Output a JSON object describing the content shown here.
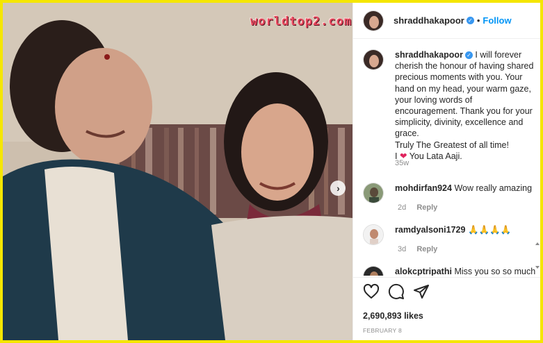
{
  "watermark": "worldtop2.com",
  "post": {
    "username": "shraddhakapoor",
    "follow_label": "Follow",
    "separator": "•",
    "caption": {
      "username": "shraddhakapoor",
      "lines": [
        "I will forever cherish the honour of having shared precious moments with you. Your hand on my head, your warm gaze, your loving words of encouragement. Thank you for your simplicity, divinity, excellence and grace.",
        "Truly The Greatest of all time!",
        "I",
        "You Lata Aaji."
      ],
      "time_ago": "35w"
    },
    "comments": [
      {
        "username": "mohdirfan924",
        "text": "Wow really amazing",
        "time": "2d",
        "reply": "Reply"
      },
      {
        "username": "ramdyalsoni1729",
        "text": "🙏🙏🙏🙏",
        "time": "3d",
        "reply": "Reply"
      },
      {
        "username": "alokcptripathi",
        "text": "Miss you so so much",
        "time": "",
        "reply": ""
      }
    ],
    "likes": "2,690,893 likes",
    "date": "FEBRUARY 8"
  },
  "icons": {
    "heart_caption": "heart-icon",
    "like": "heart-outline-icon",
    "comment": "comment-icon",
    "share": "paper-plane-icon",
    "next": "chevron-right-icon",
    "verified": "verified-badge-icon"
  },
  "colors": {
    "border": "#f5e600",
    "link_blue": "#0095f6",
    "verified_blue": "#3897f0",
    "heart_red": "#e0245e"
  }
}
